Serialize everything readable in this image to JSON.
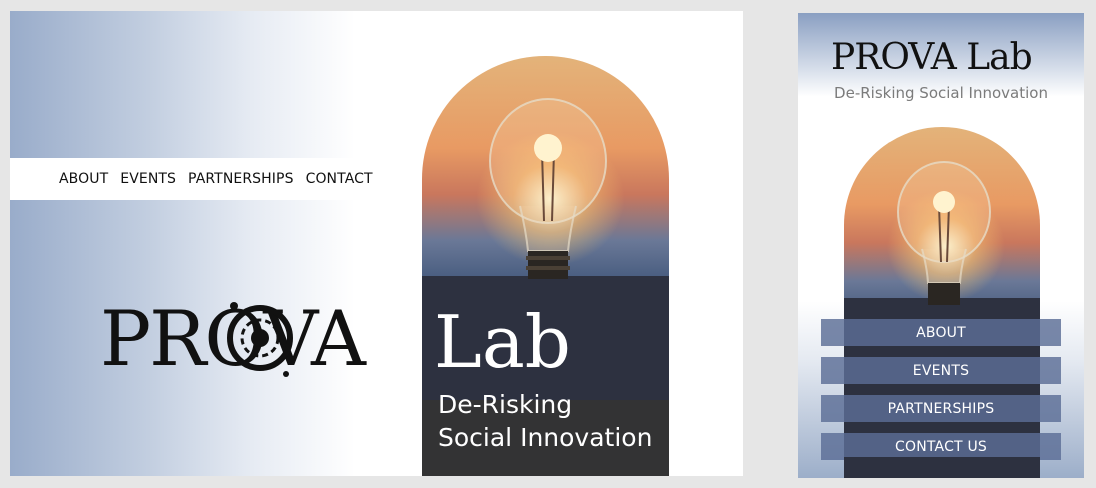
{
  "desktop": {
    "nav": {
      "about": "ABOUT",
      "events": "EVENTS",
      "partnerships": "PARTNERSHIPS",
      "contact": "CONTACT"
    },
    "logo": "PROVA",
    "logo_lab": "Lab",
    "tagline_line1": "De-Risking",
    "tagline_line2": "Social Innovation"
  },
  "mobile": {
    "logo": "PROVA Lab",
    "subtitle": "De-Risking Social Innovation",
    "menu": {
      "about": "ABOUT",
      "events": "EVENTS",
      "partnerships": "PARTNERSHIPS",
      "contact": "CONTACT US"
    }
  },
  "colors": {
    "gradient_blue": "#99acca",
    "tag_band": "#333334",
    "menu_button": "#5c6e96"
  },
  "images": {
    "hero": "lightbulb-sunset-photo"
  }
}
